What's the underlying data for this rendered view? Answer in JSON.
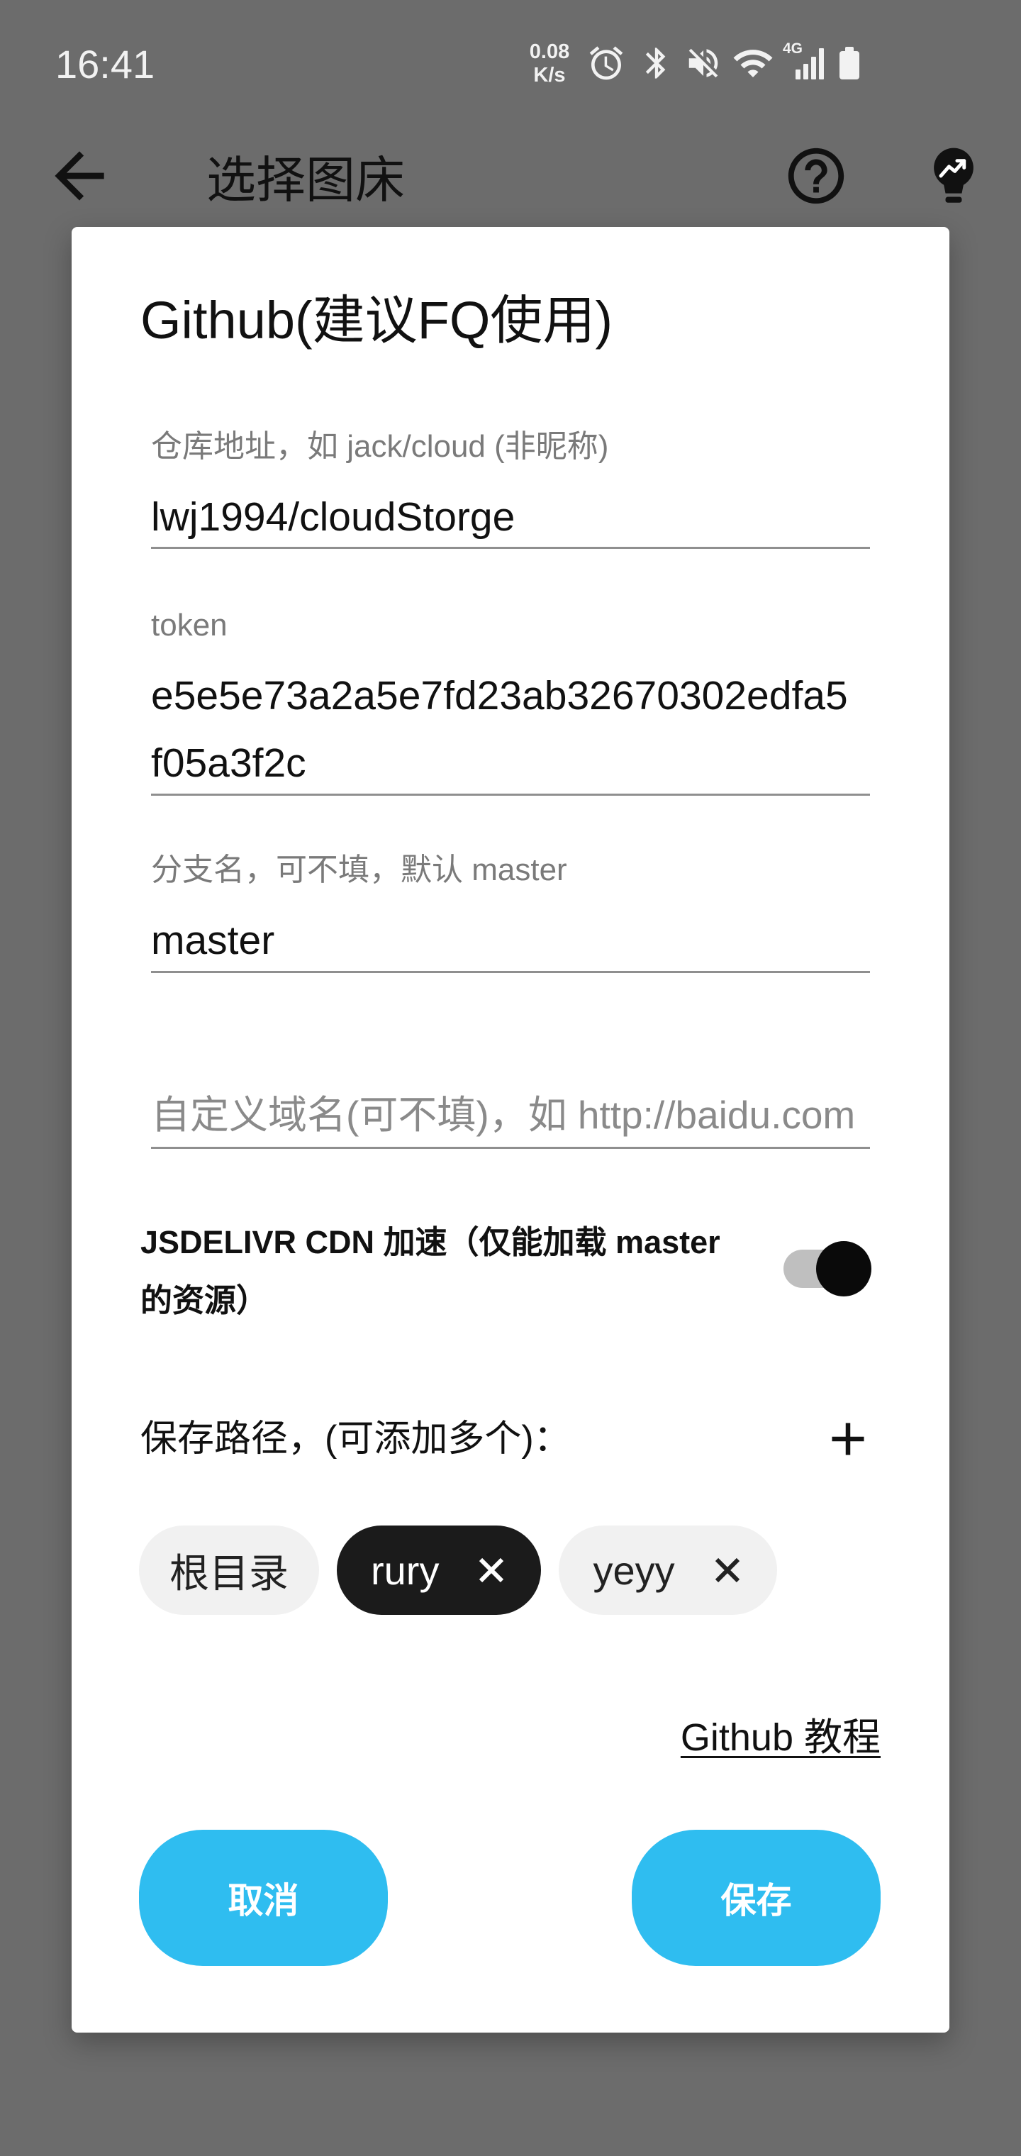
{
  "status_bar": {
    "time": "16:41",
    "net_speed_value": "0.08",
    "net_speed_unit": "K/s",
    "network_type": "4G",
    "icons": [
      "alarm-icon",
      "bluetooth-icon",
      "mute-icon",
      "wifi-icon",
      "signal-icon",
      "battery-icon"
    ],
    "battery_level": 1.0
  },
  "app_bar": {
    "title": "选择图床",
    "icons": {
      "back": "arrow-back-icon",
      "help": "help-circle-icon",
      "extra": "lightbulb-trend-icon"
    }
  },
  "dialog": {
    "title": "Github(建议FQ使用)",
    "fields": [
      {
        "label": "仓库地址，如 jack/cloud (非昵称)",
        "value": "lwj1994/cloudStorge"
      },
      {
        "label": "token",
        "value": "e5e5e73a2a5e7fd23ab32670302edfa5f05a3f2c"
      },
      {
        "label": "分支名，可不填，默认 master",
        "value": "master"
      },
      {
        "placeholder": "自定义域名(可不填)，如 http://baidu.com",
        "value": ""
      }
    ],
    "cdn_toggle": {
      "label": "JSDELIVR CDN 加速（仅能加载 master 的资源）",
      "on": true
    },
    "paths": {
      "title": "保存路径，(可添加多个)：",
      "add_icon": "plus-icon",
      "chips": [
        {
          "label": "根目录",
          "selected": false,
          "removable": false
        },
        {
          "label": "rury",
          "selected": true,
          "removable": true,
          "remove_icon": "close-icon"
        },
        {
          "label": "yeyy",
          "selected": false,
          "removable": true,
          "remove_icon": "close-icon"
        }
      ]
    },
    "tutorial_link": "Github 教程",
    "buttons": {
      "cancel": "取消",
      "save": "保存"
    }
  },
  "colors": {
    "scrim": "#6c6c6c",
    "dialog_bg": "#ffffff",
    "accent": "#2fbdf0",
    "chip_selected_bg": "#1b1b1b",
    "chip_bg": "#f1f1f1",
    "toggle_thumb": "#0a0a0a",
    "toggle_track": "#bfbfbf",
    "text_primary": "#111111",
    "text_secondary": "#7a7a7a",
    "status_fg": "#f2f2f2"
  }
}
